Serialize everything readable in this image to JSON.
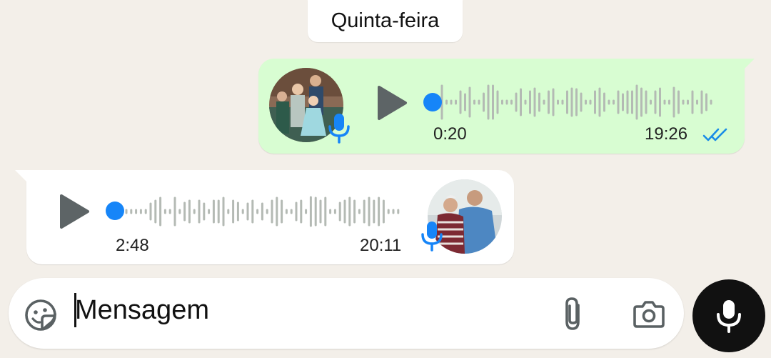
{
  "date_separator": "Quinta-feira",
  "messages": [
    {
      "direction": "outgoing",
      "type": "voice",
      "duration": "0:20",
      "time": "19:26",
      "status_icon": "double-check-icon",
      "read": true,
      "progress": 0
    },
    {
      "direction": "incoming",
      "type": "voice",
      "duration": "2:48",
      "time": "20:11",
      "progress": 0
    }
  ],
  "composer": {
    "placeholder": "Mensagem",
    "sticker_icon": "sticker-icon",
    "attach_icon": "paperclip-icon",
    "camera_icon": "camera-icon",
    "send_icon": "mic-icon"
  },
  "colors": {
    "background": "#f3efe9",
    "outgoing_bubble": "#d8fdd2",
    "incoming_bubble": "#ffffff",
    "accent_blue": "#1685f8",
    "read_check": "#1a8ce6",
    "waveform": "#b4bab4",
    "fab": "#111111"
  }
}
